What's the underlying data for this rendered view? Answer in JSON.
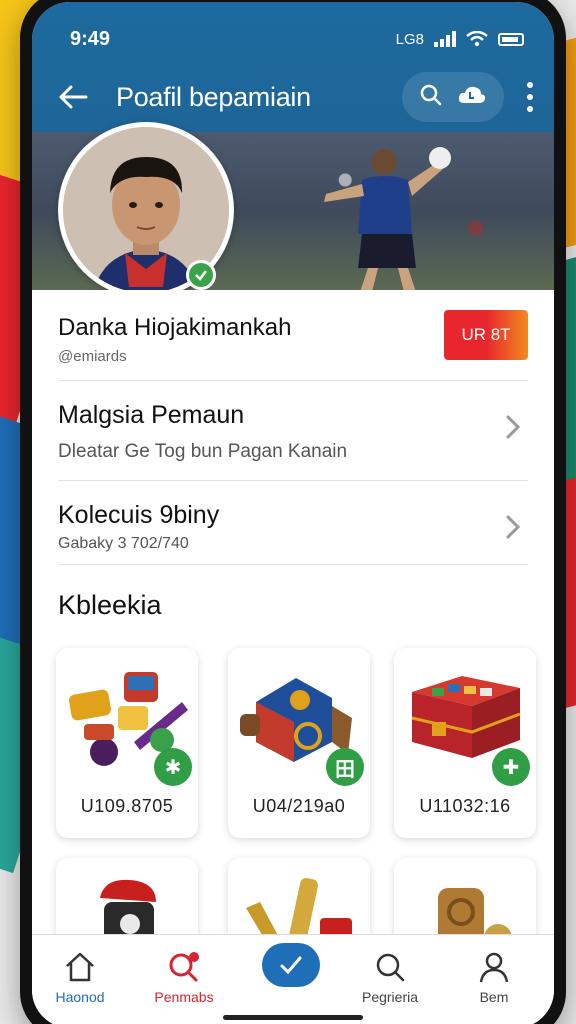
{
  "status": {
    "time": "9:49",
    "signal_text": "LG8"
  },
  "header": {
    "title": "Poafil bepamiain",
    "icons": [
      "back-arrow-icon",
      "search-icon",
      "cloud-icon",
      "more-vert-icon"
    ]
  },
  "profile": {
    "name": "Danka Hiojakimankah",
    "handle": "@emiards",
    "badge": "UR 8T"
  },
  "rows": [
    {
      "title": "Malgsia Pemaun",
      "subtitle": "Dleatar Ge Tog bun Pagan Kanain"
    },
    {
      "title": "Kolecuis 9biny",
      "subtitle": "Gabaky 3 702/740"
    }
  ],
  "collection": {
    "title": "Kbleekia",
    "items": [
      {
        "code": "U109.8705",
        "badge": "✱"
      },
      {
        "code": "U04/219a0",
        "badge": "田"
      },
      {
        "code": "U11032:16",
        "badge": "✚"
      }
    ]
  },
  "nav": {
    "items": [
      {
        "label": "Haonod",
        "icon": "home-icon"
      },
      {
        "label": "Penmabs",
        "icon": "search-heart-icon"
      },
      {
        "label": "",
        "icon": "check-icon"
      },
      {
        "label": "Pegrieria",
        "icon": "search-icon"
      },
      {
        "label": "Bem",
        "icon": "person-icon"
      }
    ]
  },
  "colors": {
    "header_blue": "#1d6aa0",
    "accent_green": "#2f9e44",
    "accent_red": "#e8262d",
    "accent_orange": "#f28a1f"
  }
}
